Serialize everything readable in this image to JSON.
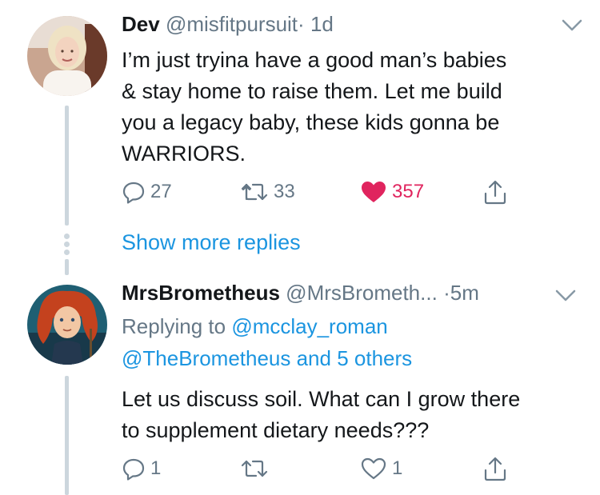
{
  "tweets": [
    {
      "display_name": "Dev",
      "handle": "@misfitpursuit",
      "separator": "·",
      "time": "1d",
      "text_lines": [
        "I’m just tryina have a good man’s babies",
        "& stay home to raise them. Let me build",
        "you a legacy baby, these kids gonna be",
        "WARRIORS."
      ],
      "actions": {
        "reply_count": "27",
        "retweet_count": "33",
        "like_count": "357",
        "liked": true
      },
      "avatar_icon": "avatar-blonde-woman"
    },
    {
      "display_name": "MrsBrometheus",
      "handle": "@MrsBrometh...",
      "separator": "·",
      "time": "5m",
      "replying_prefix": "Replying to",
      "replying_user": "@mcclay_roman",
      "replying_more": "@TheBrometheus and 5 others",
      "text_lines": [
        "Let us discuss soil. What can I grow there",
        "to supplement dietary needs???"
      ],
      "actions": {
        "reply_count": "1",
        "retweet_count": "",
        "like_count": "1",
        "liked": false
      },
      "avatar_icon": "avatar-red-haired-cartoon"
    }
  ],
  "show_more_replies": "Show more replies",
  "colors": {
    "link": "#1b95e0",
    "muted": "#657786",
    "like": "#e0245e",
    "thread": "#ccd6dd"
  }
}
